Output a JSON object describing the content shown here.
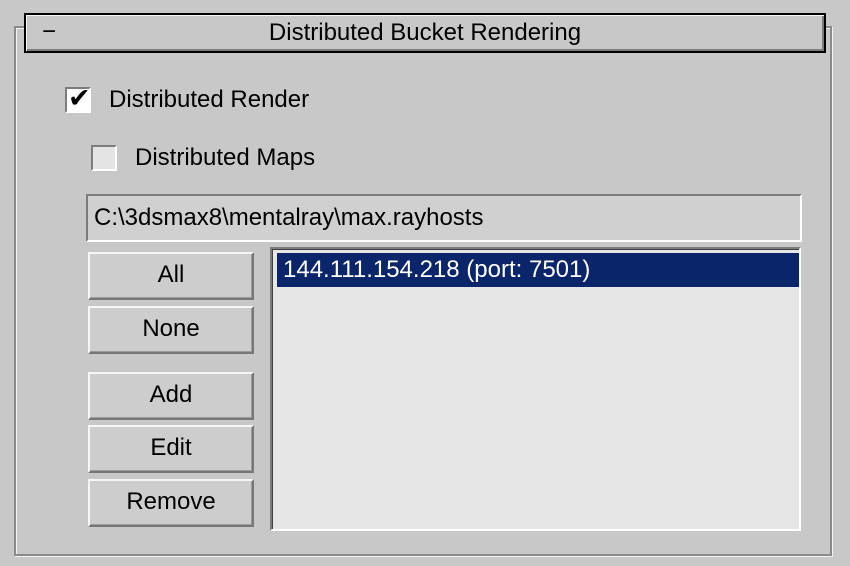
{
  "rollout": {
    "collapse_symbol": "−",
    "title": "Distributed Bucket Rendering"
  },
  "options": {
    "distributed_render": {
      "label": "Distributed Render",
      "checked": true,
      "check_mark": "✔"
    },
    "distributed_maps": {
      "label": "Distributed Maps",
      "checked": false
    }
  },
  "path_field": {
    "value": "C:\\3dsmax8\\mentalray\\max.rayhosts"
  },
  "buttons": {
    "all": "All",
    "none": "None",
    "add": "Add",
    "edit": "Edit",
    "remove": "Remove"
  },
  "hosts": [
    {
      "label": "144.111.154.218 (port: 7501)",
      "selected": true
    }
  ],
  "colors": {
    "panel_background": "#c8c8c8",
    "list_background": "#e6e6e6",
    "selection": "#0b256a",
    "selection_text": "#ffffff"
  },
  "icons": {
    "collapse": "minus-icon",
    "checkbox_checked": "checkmark-icon"
  }
}
